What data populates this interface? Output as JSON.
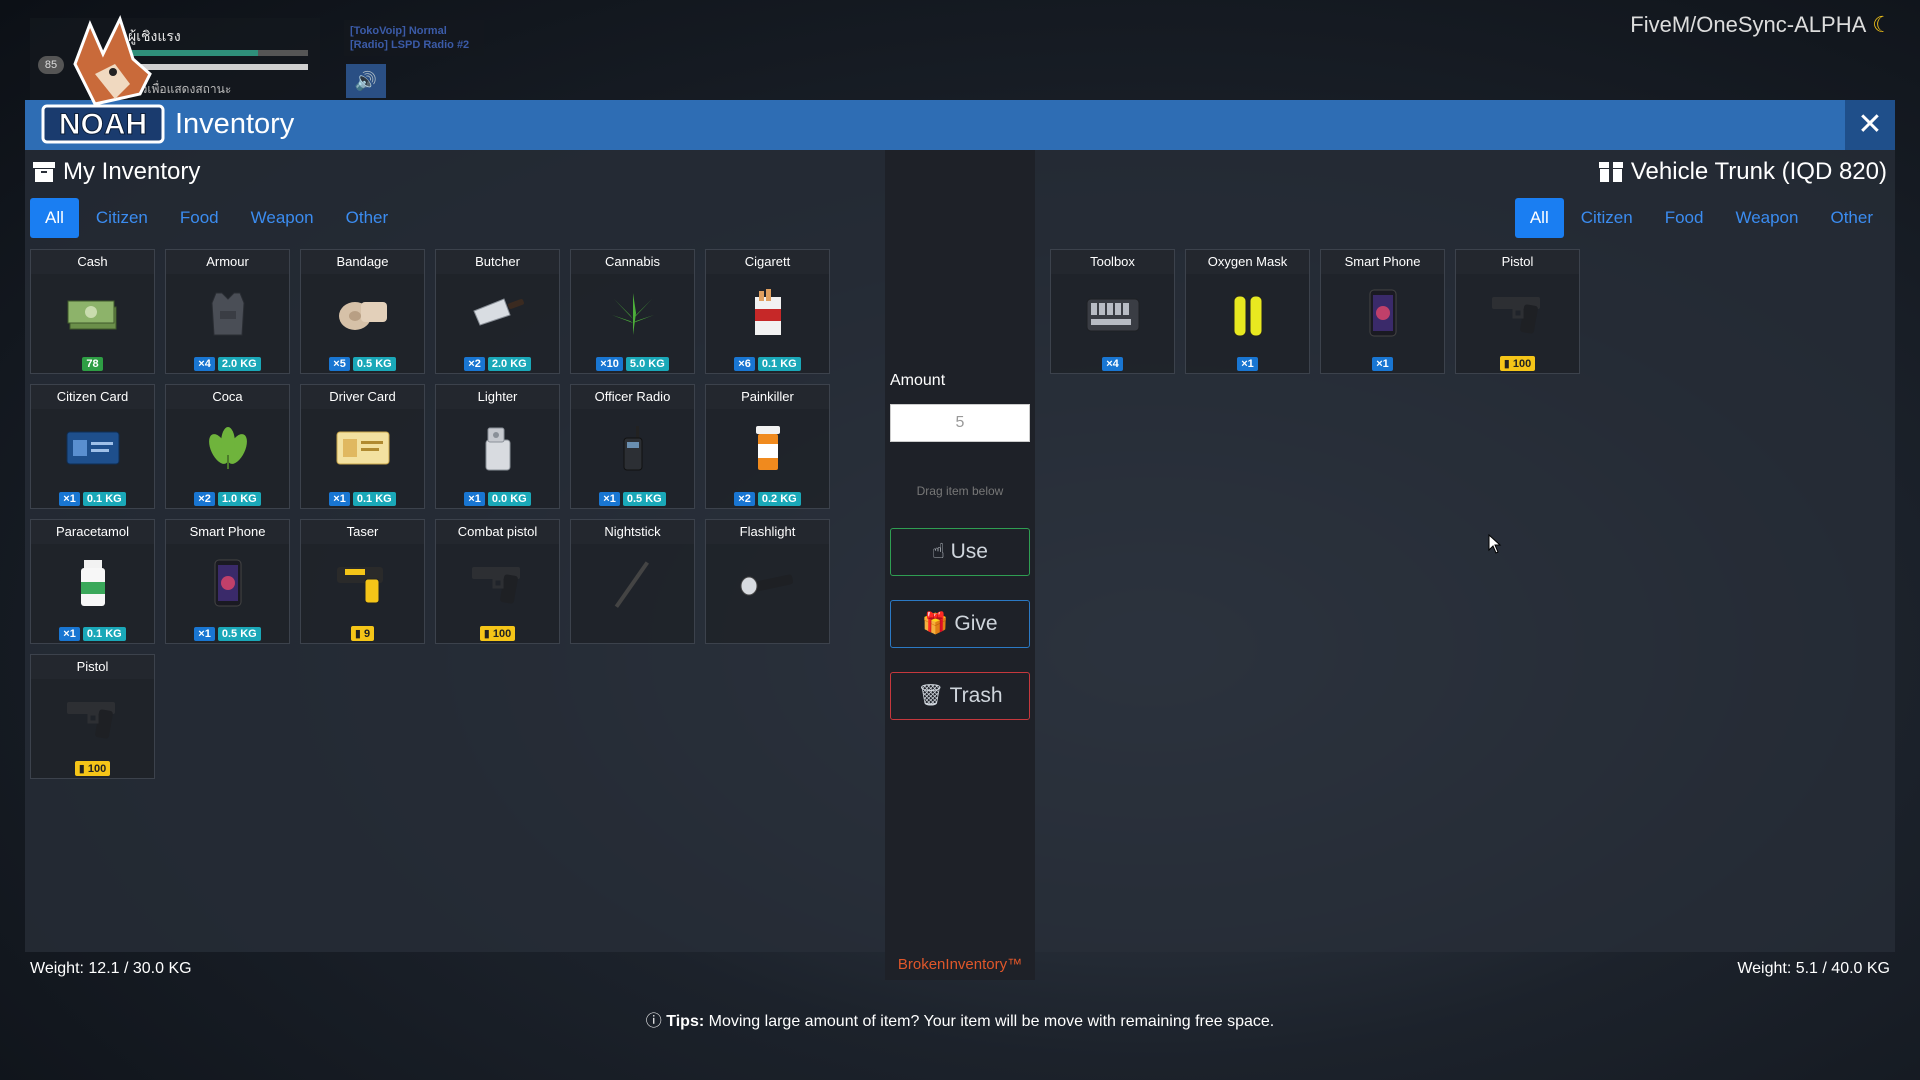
{
  "hud": {
    "player_name": "ผู้เชิงแรง",
    "level": "85",
    "status_text": "1) ค้างไว้เพื่อแสดงสถานะ",
    "voip_line1": "[TokoVoip] Normal",
    "voip_line2": "[Radio] LSPD Radio #2",
    "server_tag": "FiveM/OneSync-ALPHA",
    "health_pct": 0.72,
    "armor_pct": 1.0
  },
  "window": {
    "logo_text": "NOAH",
    "title": "Inventory"
  },
  "left": {
    "heading": "My Inventory",
    "tabs": [
      "All",
      "Citizen",
      "Food",
      "Weapon",
      "Other"
    ],
    "weight": "Weight: 12.1 / 30.0 KG",
    "items": [
      {
        "name": "Cash",
        "icon": "cash-icon",
        "badges": [
          {
            "t": "78",
            "k": "green"
          }
        ]
      },
      {
        "name": "Armour",
        "icon": "armour-vest-icon",
        "badges": [
          {
            "t": "×4",
            "k": "qty"
          },
          {
            "t": "2.0 KG",
            "k": "kg"
          }
        ]
      },
      {
        "name": "Bandage",
        "icon": "bandage-icon",
        "badges": [
          {
            "t": "×5",
            "k": "qty"
          },
          {
            "t": "0.5 KG",
            "k": "kg"
          }
        ]
      },
      {
        "name": "Butcher",
        "icon": "cleaver-icon",
        "badges": [
          {
            "t": "×2",
            "k": "qty"
          },
          {
            "t": "2.0 KG",
            "k": "kg"
          }
        ]
      },
      {
        "name": "Cannabis",
        "icon": "cannabis-leaf-icon",
        "badges": [
          {
            "t": "×10",
            "k": "qty"
          },
          {
            "t": "5.0 KG",
            "k": "kg"
          }
        ]
      },
      {
        "name": "Cigarett",
        "icon": "cigarette-pack-icon",
        "badges": [
          {
            "t": "×6",
            "k": "qty"
          },
          {
            "t": "0.1 KG",
            "k": "kg"
          }
        ]
      },
      {
        "name": "Citizen Card",
        "icon": "id-card-icon",
        "badges": [
          {
            "t": "×1",
            "k": "qty"
          },
          {
            "t": "0.1 KG",
            "k": "kg"
          }
        ]
      },
      {
        "name": "Coca",
        "icon": "coca-leaf-icon",
        "badges": [
          {
            "t": "×2",
            "k": "qty"
          },
          {
            "t": "1.0 KG",
            "k": "kg"
          }
        ]
      },
      {
        "name": "Driver Card",
        "icon": "driver-license-icon",
        "badges": [
          {
            "t": "×1",
            "k": "qty"
          },
          {
            "t": "0.1 KG",
            "k": "kg"
          }
        ]
      },
      {
        "name": "Lighter",
        "icon": "lighter-icon",
        "badges": [
          {
            "t": "×1",
            "k": "qty"
          },
          {
            "t": "0.0 KG",
            "k": "kg"
          }
        ]
      },
      {
        "name": "Officer Radio",
        "icon": "radio-icon",
        "badges": [
          {
            "t": "×1",
            "k": "qty"
          },
          {
            "t": "0.5 KG",
            "k": "kg"
          }
        ]
      },
      {
        "name": "Painkiller",
        "icon": "pill-bottle-icon",
        "badges": [
          {
            "t": "×2",
            "k": "qty"
          },
          {
            "t": "0.2 KG",
            "k": "kg"
          }
        ]
      },
      {
        "name": "Paracetamol",
        "icon": "medicine-bottle-icon",
        "badges": [
          {
            "t": "×1",
            "k": "qty"
          },
          {
            "t": "0.1 KG",
            "k": "kg"
          }
        ]
      },
      {
        "name": "Smart Phone",
        "icon": "smartphone-icon",
        "badges": [
          {
            "t": "×1",
            "k": "qty"
          },
          {
            "t": "0.5 KG",
            "k": "kg"
          }
        ]
      },
      {
        "name": "Taser",
        "icon": "taser-icon",
        "badges": [
          {
            "t": "9",
            "k": "ammo"
          }
        ]
      },
      {
        "name": "Combat pistol",
        "icon": "pistol-icon",
        "badges": [
          {
            "t": "100",
            "k": "ammo"
          }
        ]
      },
      {
        "name": "Nightstick",
        "icon": "nightstick-icon",
        "badges": []
      },
      {
        "name": "Flashlight",
        "icon": "flashlight-icon",
        "badges": []
      },
      {
        "name": "Pistol",
        "icon": "pistol-icon",
        "badges": [
          {
            "t": "100",
            "k": "ammo"
          }
        ]
      }
    ]
  },
  "right": {
    "heading": "Vehicle Trunk (IQD 820)",
    "tabs": [
      "All",
      "Citizen",
      "Food",
      "Weapon",
      "Other"
    ],
    "weight": "Weight: 5.1 / 40.0 KG",
    "items": [
      {
        "name": "Toolbox",
        "icon": "toolbox-icon",
        "badges": [
          {
            "t": "×4",
            "k": "qty"
          }
        ]
      },
      {
        "name": "Oxygen Mask",
        "icon": "oxygen-tank-icon",
        "badges": [
          {
            "t": "×1",
            "k": "qty"
          }
        ]
      },
      {
        "name": "Smart Phone",
        "icon": "smartphone-icon",
        "badges": [
          {
            "t": "×1",
            "k": "qty"
          }
        ]
      },
      {
        "name": "Pistol",
        "icon": "pistol-icon",
        "badges": [
          {
            "t": "100",
            "k": "ammo"
          }
        ]
      }
    ]
  },
  "middle": {
    "amount_label": "Amount",
    "amount_value": "5",
    "drag_hint": "Drag item below",
    "use_label": "Use",
    "give_label": "Give",
    "trash_label": "Trash",
    "brand": "BrokenInventory™"
  },
  "tips": {
    "label": "Tips:",
    "text": "Moving large amount of item? Your item will be move with remaining free space."
  },
  "colors": {
    "accent": "#2e6db4",
    "tab_active": "#1a7ef2",
    "use": "#2f9e52",
    "give": "#2b79c4",
    "trash": "#c6383d",
    "brand": "#e0572a"
  }
}
